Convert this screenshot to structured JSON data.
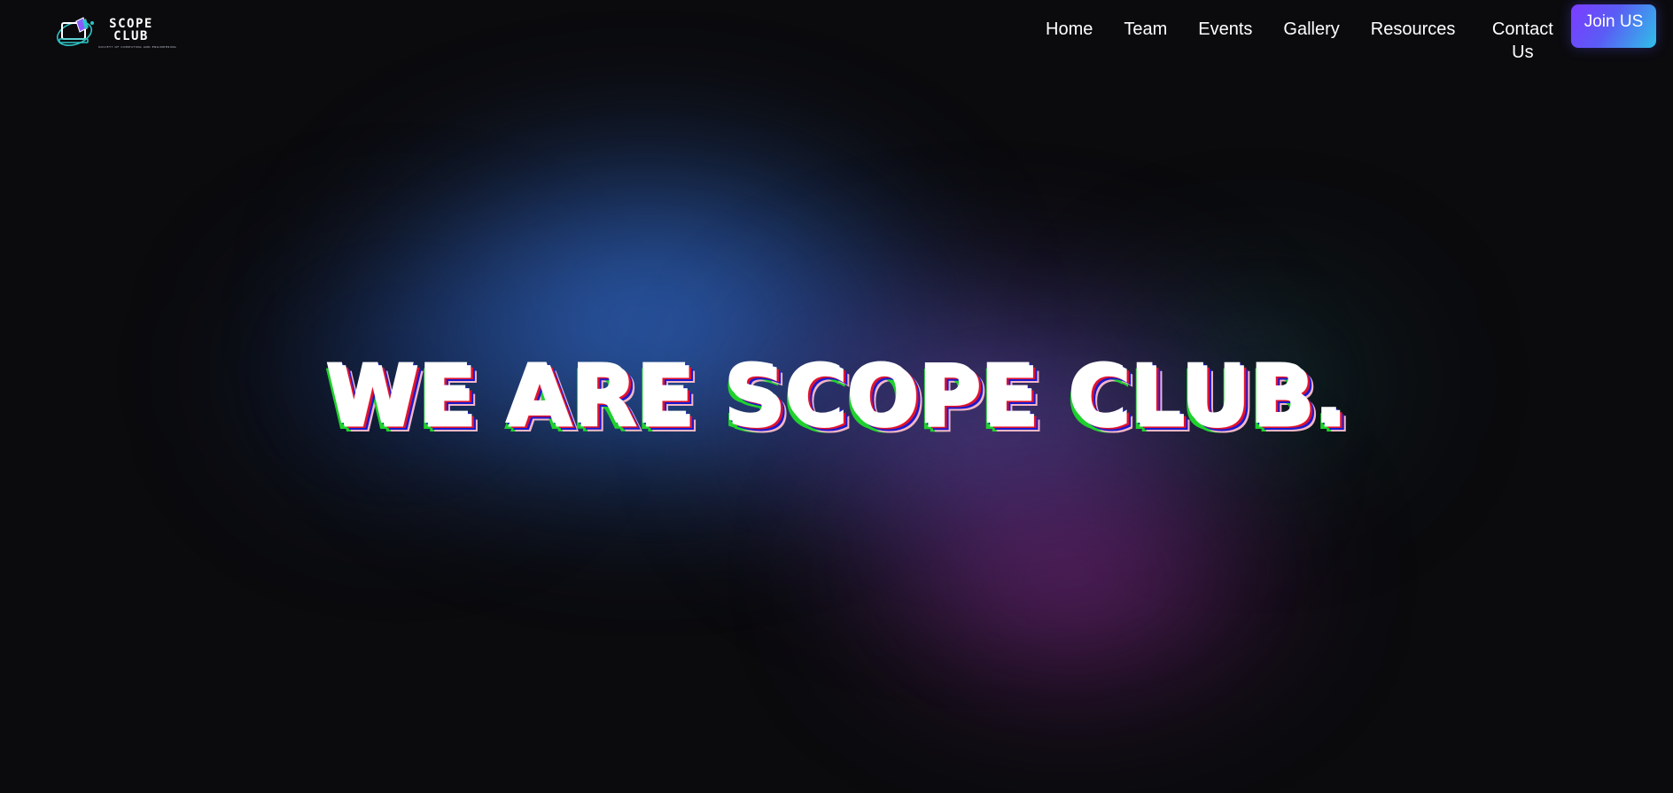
{
  "brand": {
    "name_line1": "SCOPE",
    "name_line2": "CLUB",
    "tagline": "SOCIETY OF COMPUTING AND ENGINEERING",
    "logo_icon": "laptop-orbit-icon",
    "colors": {
      "logo_teal": "#2ec4c4",
      "logo_violet": "#8a5cff"
    }
  },
  "nav": {
    "items": [
      {
        "label": "Home"
      },
      {
        "label": "Team"
      },
      {
        "label": "Events"
      },
      {
        "label": "Gallery"
      },
      {
        "label": "Resources"
      },
      {
        "label": "Contact Us"
      }
    ],
    "join_label": "Join US",
    "join_gradient": [
      "#7c3cff",
      "#2fc0e8"
    ]
  },
  "hero": {
    "title": "WE ARE SCOPE CLUB.",
    "glitch_colors": [
      "#e0132d",
      "#1fd12c",
      "#1a1ad0"
    ]
  },
  "background": {
    "base": "#0b0b0e",
    "glow_colors": [
      "#346ecd",
      "#5f50aa",
      "#7d2882"
    ]
  }
}
